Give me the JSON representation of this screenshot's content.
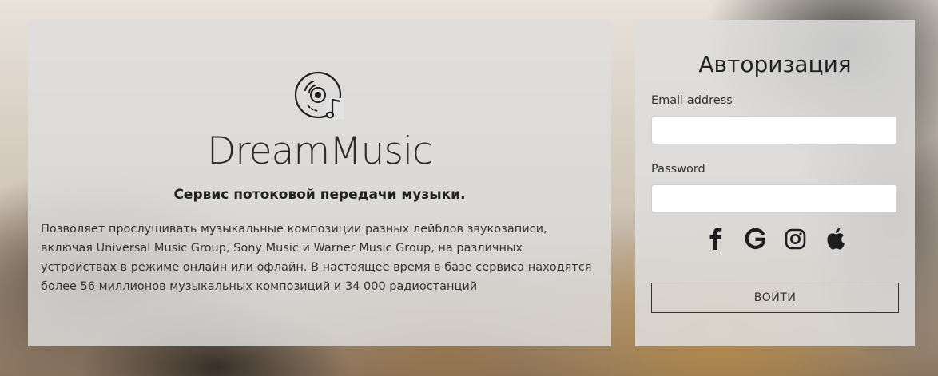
{
  "brand": {
    "name": "DreamMusic",
    "logo_icon": "music-disc-icon"
  },
  "about": {
    "tagline": "Сервис потоковой передачи музыки.",
    "description": "Позволяет прослушивать музыкальные композиции разных лейблов звукозаписи, включая Universal Music Group, Sony Music и Warner Music Group, на различных устройствах в режиме онлайн или офлайн. В настоящее время в базе сервиса находятся более 56 миллионов музыкальных композиций и 34 000 радиостанций"
  },
  "auth": {
    "title": "Авторизация",
    "email_label": "Email address",
    "email_value": "",
    "password_label": "Password",
    "password_value": "",
    "social_icons": [
      "facebook-icon",
      "google-icon",
      "instagram-icon",
      "apple-icon"
    ],
    "submit_label": "ВОЙТИ"
  },
  "colors": {
    "text": "#222222",
    "panel": "#dedede"
  }
}
